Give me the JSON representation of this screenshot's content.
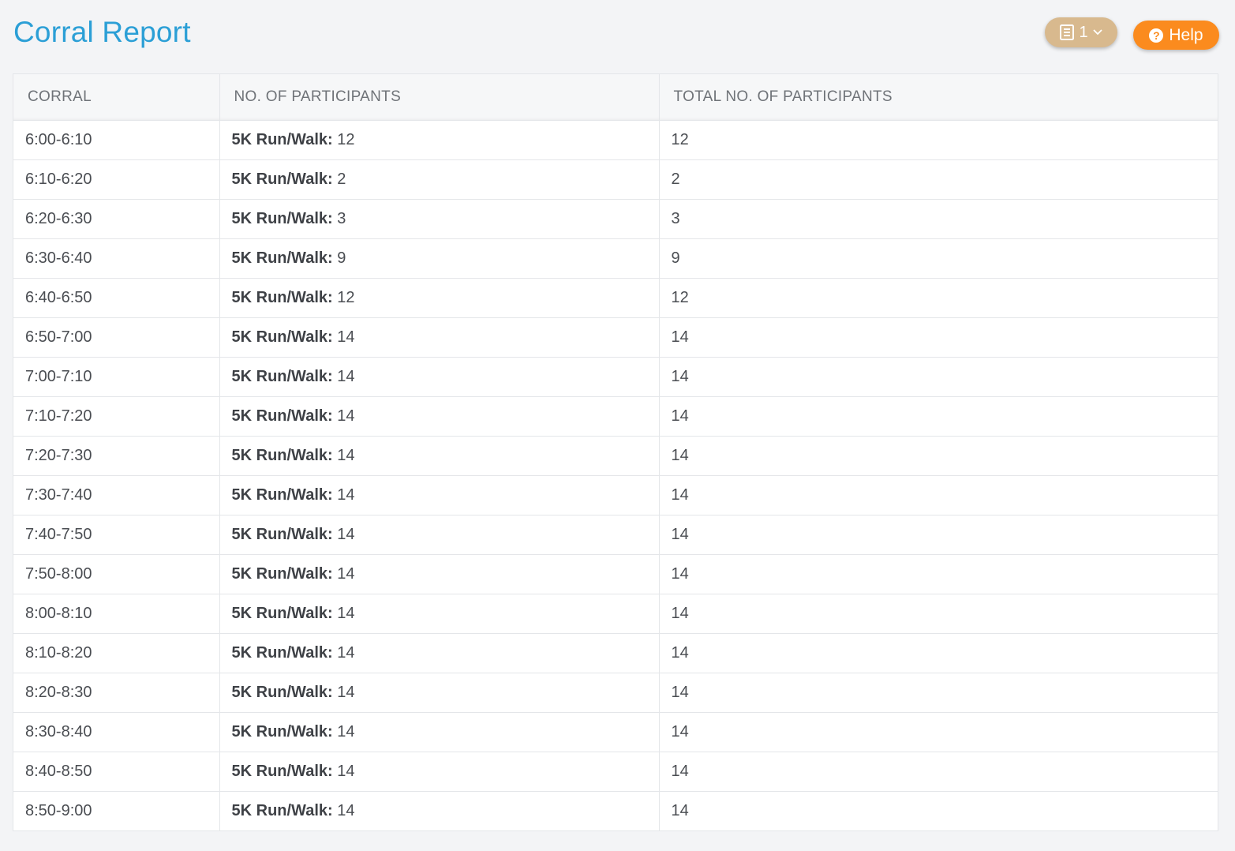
{
  "header": {
    "title": "Corral Report",
    "report_count": "1",
    "help_label": "Help"
  },
  "table": {
    "columns": [
      "CORRAL",
      "NO. OF PARTICIPANTS",
      "TOTAL NO. OF PARTICIPANTS"
    ],
    "event_label": "5K Run/Walk:",
    "rows": [
      {
        "corral": "6:00-6:10",
        "count": "12",
        "total": "12"
      },
      {
        "corral": "6:10-6:20",
        "count": "2",
        "total": "2"
      },
      {
        "corral": "6:20-6:30",
        "count": "3",
        "total": "3"
      },
      {
        "corral": "6:30-6:40",
        "count": "9",
        "total": "9"
      },
      {
        "corral": "6:40-6:50",
        "count": "12",
        "total": "12"
      },
      {
        "corral": "6:50-7:00",
        "count": "14",
        "total": "14"
      },
      {
        "corral": "7:00-7:10",
        "count": "14",
        "total": "14"
      },
      {
        "corral": "7:10-7:20",
        "count": "14",
        "total": "14"
      },
      {
        "corral": "7:20-7:30",
        "count": "14",
        "total": "14"
      },
      {
        "corral": "7:30-7:40",
        "count": "14",
        "total": "14"
      },
      {
        "corral": "7:40-7:50",
        "count": "14",
        "total": "14"
      },
      {
        "corral": "7:50-8:00",
        "count": "14",
        "total": "14"
      },
      {
        "corral": "8:00-8:10",
        "count": "14",
        "total": "14"
      },
      {
        "corral": "8:10-8:20",
        "count": "14",
        "total": "14"
      },
      {
        "corral": "8:20-8:30",
        "count": "14",
        "total": "14"
      },
      {
        "corral": "8:30-8:40",
        "count": "14",
        "total": "14"
      },
      {
        "corral": "8:40-8:50",
        "count": "14",
        "total": "14"
      },
      {
        "corral": "8:50-9:00",
        "count": "14",
        "total": "14"
      }
    ]
  },
  "colors": {
    "title": "#2b9fd6",
    "report_pill": "#d8b98e",
    "help_button": "#fb8b1e",
    "background": "#f3f4f6"
  },
  "icons": {
    "report": "document-list-icon",
    "dropdown": "chevron-down-icon",
    "help": "question-circle-icon"
  }
}
